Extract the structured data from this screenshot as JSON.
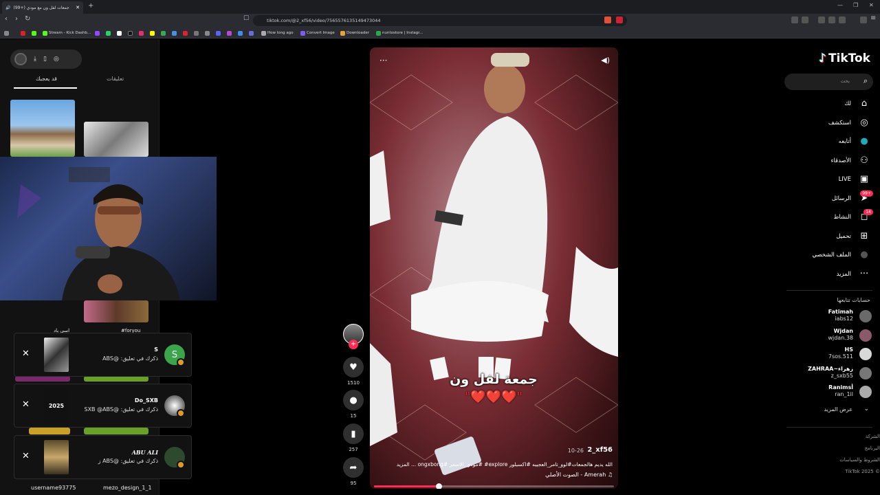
{
  "browser": {
    "tab_title": "(99+) جمعات لفل ون مع مودي",
    "url": "tiktok.com/@2_xf56/video/7565576135149473044",
    "bookmarks": [
      "Stream - Kick Dashb...",
      "How long ago",
      "Convert Image",
      "Downloader",
      "nuntostore | Instagr..."
    ]
  },
  "left_panel": {
    "tabs": [
      "قد يعجبك",
      "تعليقات"
    ],
    "camera_labels": [
      "#foryou",
      "اسي باد"
    ],
    "bottom_users": [
      "username93775",
      "mezo_design_1_1"
    ]
  },
  "notifications": [
    {
      "name": "S",
      "text": "ذكرك في تعليق: @ABS",
      "avatar_letter": "S",
      "avatar_color": "#3aa54a"
    },
    {
      "name": "Do_SXB",
      "text": "ذكرك في تعليق: @SXB @ABS",
      "thumb_text": "2025",
      "avatar_letter": "",
      "avatar_color": "#dddddd"
    },
    {
      "name": "ABU ALI",
      "text": "ذكرك في تعليق: @ABS ز",
      "avatar_letter": "",
      "avatar_color": "#2e4a2e"
    }
  ],
  "video": {
    "caption_title": "جمعة لفل ون",
    "caption_hearts": "\"❤️❤️❤️\"",
    "username": "2_xf56",
    "date": "10-26",
    "description": "الله يديم هالجمعات#لوو_تامر_العجيبه #اكسبلور explore# #مودي_الاسمر #ongxbong ... المزيد",
    "music": "♫ Amerah - الصوت الأصلي",
    "progress": 0.27
  },
  "actions": {
    "likes": "1510",
    "comments": "15",
    "saves": "257",
    "shares": "95"
  },
  "sidebar": {
    "logo": "TikTok",
    "search_placeholder": "بحث",
    "nav": [
      {
        "label": "لك",
        "icon": "home-icon",
        "glyph": "⌂"
      },
      {
        "label": "استكشف",
        "icon": "compass-icon",
        "glyph": "◎"
      },
      {
        "label": "أتابعه",
        "icon": "following-avatar-icon",
        "glyph": "●"
      },
      {
        "label": "الأصدقاء",
        "icon": "friends-icon",
        "glyph": "⚇"
      },
      {
        "label": "LIVE",
        "icon": "live-icon",
        "glyph": "▣"
      },
      {
        "label": "الرسائل",
        "icon": "messages-icon",
        "glyph": "➤",
        "badge": "99+"
      },
      {
        "label": "النشاط",
        "icon": "activity-icon",
        "glyph": "◻",
        "badge": "14"
      },
      {
        "label": "تحميل",
        "icon": "upload-icon",
        "glyph": "⊞"
      },
      {
        "label": "الملف الشخصي",
        "icon": "profile-icon",
        "glyph": "●"
      },
      {
        "label": "المزيد",
        "icon": "more-icon",
        "glyph": "···"
      }
    ],
    "following_title": "حسابات تتابعها",
    "following": [
      {
        "name": "Fatimah",
        "handle": "iabs12"
      },
      {
        "name": "Wjdan",
        "handle": "wjdan.38"
      },
      {
        "name": "HS",
        "handle": "7sos.511"
      },
      {
        "name": "ZAHRAA~زهراء",
        "handle": "z_sxb55"
      },
      {
        "name": "Ranimsأ",
        "handle": "ran_1il"
      }
    ],
    "see_more": "عرض المزيد",
    "footer": [
      "الشركة",
      "البرنامج",
      "الشروط والسياسات",
      "© 2025 TikTok"
    ]
  },
  "colors": {
    "accent": "#fe2c55",
    "background": "#000000",
    "panel": "#121212"
  }
}
